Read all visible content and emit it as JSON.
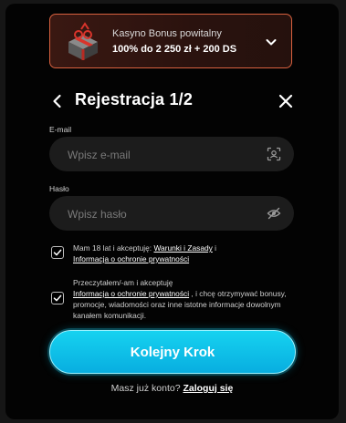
{
  "bonus": {
    "title": "Kasyno Bonus powitalny",
    "value": "100% do 2 250 zł + 200 DS"
  },
  "header": {
    "title": "Rejestracja 1/2"
  },
  "email": {
    "label": "E-mail",
    "placeholder": "Wpisz e-mail"
  },
  "password": {
    "label": "Hasło",
    "placeholder": "Wpisz hasło"
  },
  "terms": {
    "checked": true,
    "text_before": "Mam 18 lat i akceptuję: ",
    "link_terms": "Warunki i Zasady",
    "text_mid": " i ",
    "link_privacy": "Informacja o ochronie prywatności"
  },
  "marketing": {
    "checked": true,
    "text_before": "Przeczytałem/-am i akceptuję ",
    "link_privacy": "Informacja o ochronie prywatności",
    "text_after": " , i chcę otrzymywać bonusy, promocje, wiadomości oraz inne istotne informacje dowolnym kanałem komunikacji."
  },
  "cta": {
    "label": "Kolejny Krok"
  },
  "footer": {
    "question": "Masz już konto? ",
    "login": "Zaloguj się"
  },
  "colors": {
    "accent": "#08aee0",
    "bonus_border": "#d8613f",
    "background": "#030303"
  },
  "icons": {
    "bonus": "gift-box-icon",
    "expand": "chevron-down-icon",
    "back": "arrow-left-icon",
    "close": "close-icon",
    "email_field": "face-scan-icon",
    "password_field": "eye-off-icon",
    "check": "checkmark-icon"
  }
}
